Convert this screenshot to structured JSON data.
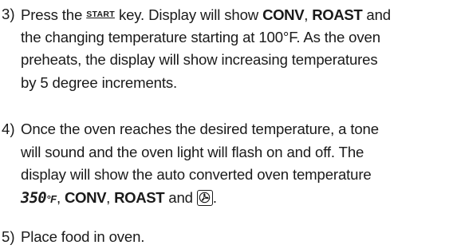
{
  "steps": [
    {
      "number": "3)",
      "l1_pre": "Press the ",
      "key_label": "START",
      "l1_mid": " key. Display will show ",
      "conv": "CONV",
      "sep1": ", ",
      "roast": "ROAST",
      "l1_post": " and",
      "l2": "the changing temperature starting at 100°F. As the oven",
      "l3": "preheats, the display will show increasing temperatures",
      "l4": "by 5 degree increments."
    },
    {
      "number": "4)",
      "l1": "Once the oven reaches the desired temperature, a tone",
      "l2": "will sound and the oven light will flash on and off. The",
      "l3": "display will show the auto converted oven temperature",
      "display_temp": "350",
      "display_unit": "°F",
      "sep1": ", ",
      "conv": "CONV",
      "sep2": ", ",
      "roast": "ROAST",
      "and_text": " and ",
      "fan_icon": "convection-fan-icon",
      "end": "."
    },
    {
      "number": "5)",
      "l1": "Place food in oven."
    }
  ]
}
